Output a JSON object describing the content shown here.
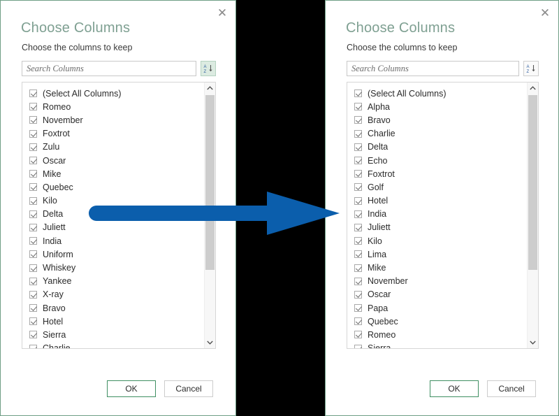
{
  "meta": {
    "arrow_color": "#0B5EAC",
    "title_color": "#7FA092",
    "dialog_border_color": "#6F9E86",
    "primary_button_border": "#3F8F62",
    "backdrop_color": "#000000"
  },
  "dialogs": [
    {
      "id": "before",
      "title": "Choose Columns",
      "subtitle": "Choose the columns to keep",
      "close_label": "✕",
      "search": {
        "value": "",
        "placeholder": "Search Columns"
      },
      "sort_button": {
        "name": "sort-az-button",
        "icon": "sort-a-to-z-icon",
        "top_letter": "A",
        "bottom_letter": "Z",
        "active": true
      },
      "list": {
        "items": [
          "(Select All Columns)",
          "Romeo",
          "November",
          "Foxtrot",
          "Zulu",
          "Oscar",
          "Mike",
          "Quebec",
          "Kilo",
          "Delta",
          "Juliett",
          "India",
          "Uniform",
          "Whiskey",
          "Yankee",
          "X-ray",
          "Bravo",
          "Hotel",
          "Sierra",
          "Charlie"
        ],
        "all_checked": true
      },
      "buttons": {
        "ok": "OK",
        "cancel": "Cancel"
      }
    },
    {
      "id": "after",
      "title": "Choose Columns",
      "subtitle": "Choose the columns to keep",
      "close_label": "✕",
      "search": {
        "value": "",
        "placeholder": "Search Columns"
      },
      "sort_button": {
        "name": "sort-az-button",
        "icon": "sort-a-to-z-icon",
        "top_letter": "A",
        "bottom_letter": "Z",
        "active": false
      },
      "list": {
        "items": [
          "(Select All Columns)",
          "Alpha",
          "Bravo",
          "Charlie",
          "Delta",
          "Echo",
          "Foxtrot",
          "Golf",
          "Hotel",
          "India",
          "Juliett",
          "Kilo",
          "Lima",
          "Mike",
          "November",
          "Oscar",
          "Papa",
          "Quebec",
          "Romeo",
          "Sierra"
        ],
        "all_checked": true
      },
      "buttons": {
        "ok": "OK",
        "cancel": "Cancel"
      }
    }
  ]
}
